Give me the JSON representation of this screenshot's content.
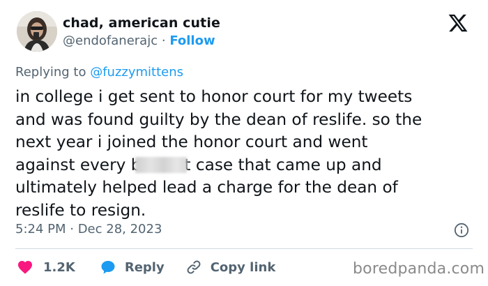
{
  "author": {
    "name": "chad, american cutie",
    "handle": "@endofanerajc",
    "separator": "·",
    "follow_label": "Follow"
  },
  "reply": {
    "prefix": "Replying to",
    "mention": "@fuzzymittens"
  },
  "tweet": {
    "lines": [
      "in college i get sent to honor court for my tweets",
      "and was found guilty by the dean of reslife. so the",
      "next year i joined the honor court and went"
    ],
    "line4_before": "against every b",
    "line4_after": "t case that came up and",
    "lines_end": [
      "ultimately helped lead a charge for the dean of",
      "reslife to resign."
    ]
  },
  "meta": {
    "timestamp": "5:24 PM · Dec 28, 2023"
  },
  "actions": {
    "like_count": "1.2K",
    "reply_label": "Reply",
    "copy_link_label": "Copy link"
  },
  "watermark": "boredpanda.com",
  "colors": {
    "accent": "#1d9bf0",
    "like": "#f91880",
    "text": "#0f1419",
    "muted": "#536471",
    "divider": "#cfd9de"
  },
  "icons": [
    "x-logo-icon",
    "info-icon",
    "heart-icon",
    "reply-bubble-icon",
    "link-icon"
  ]
}
